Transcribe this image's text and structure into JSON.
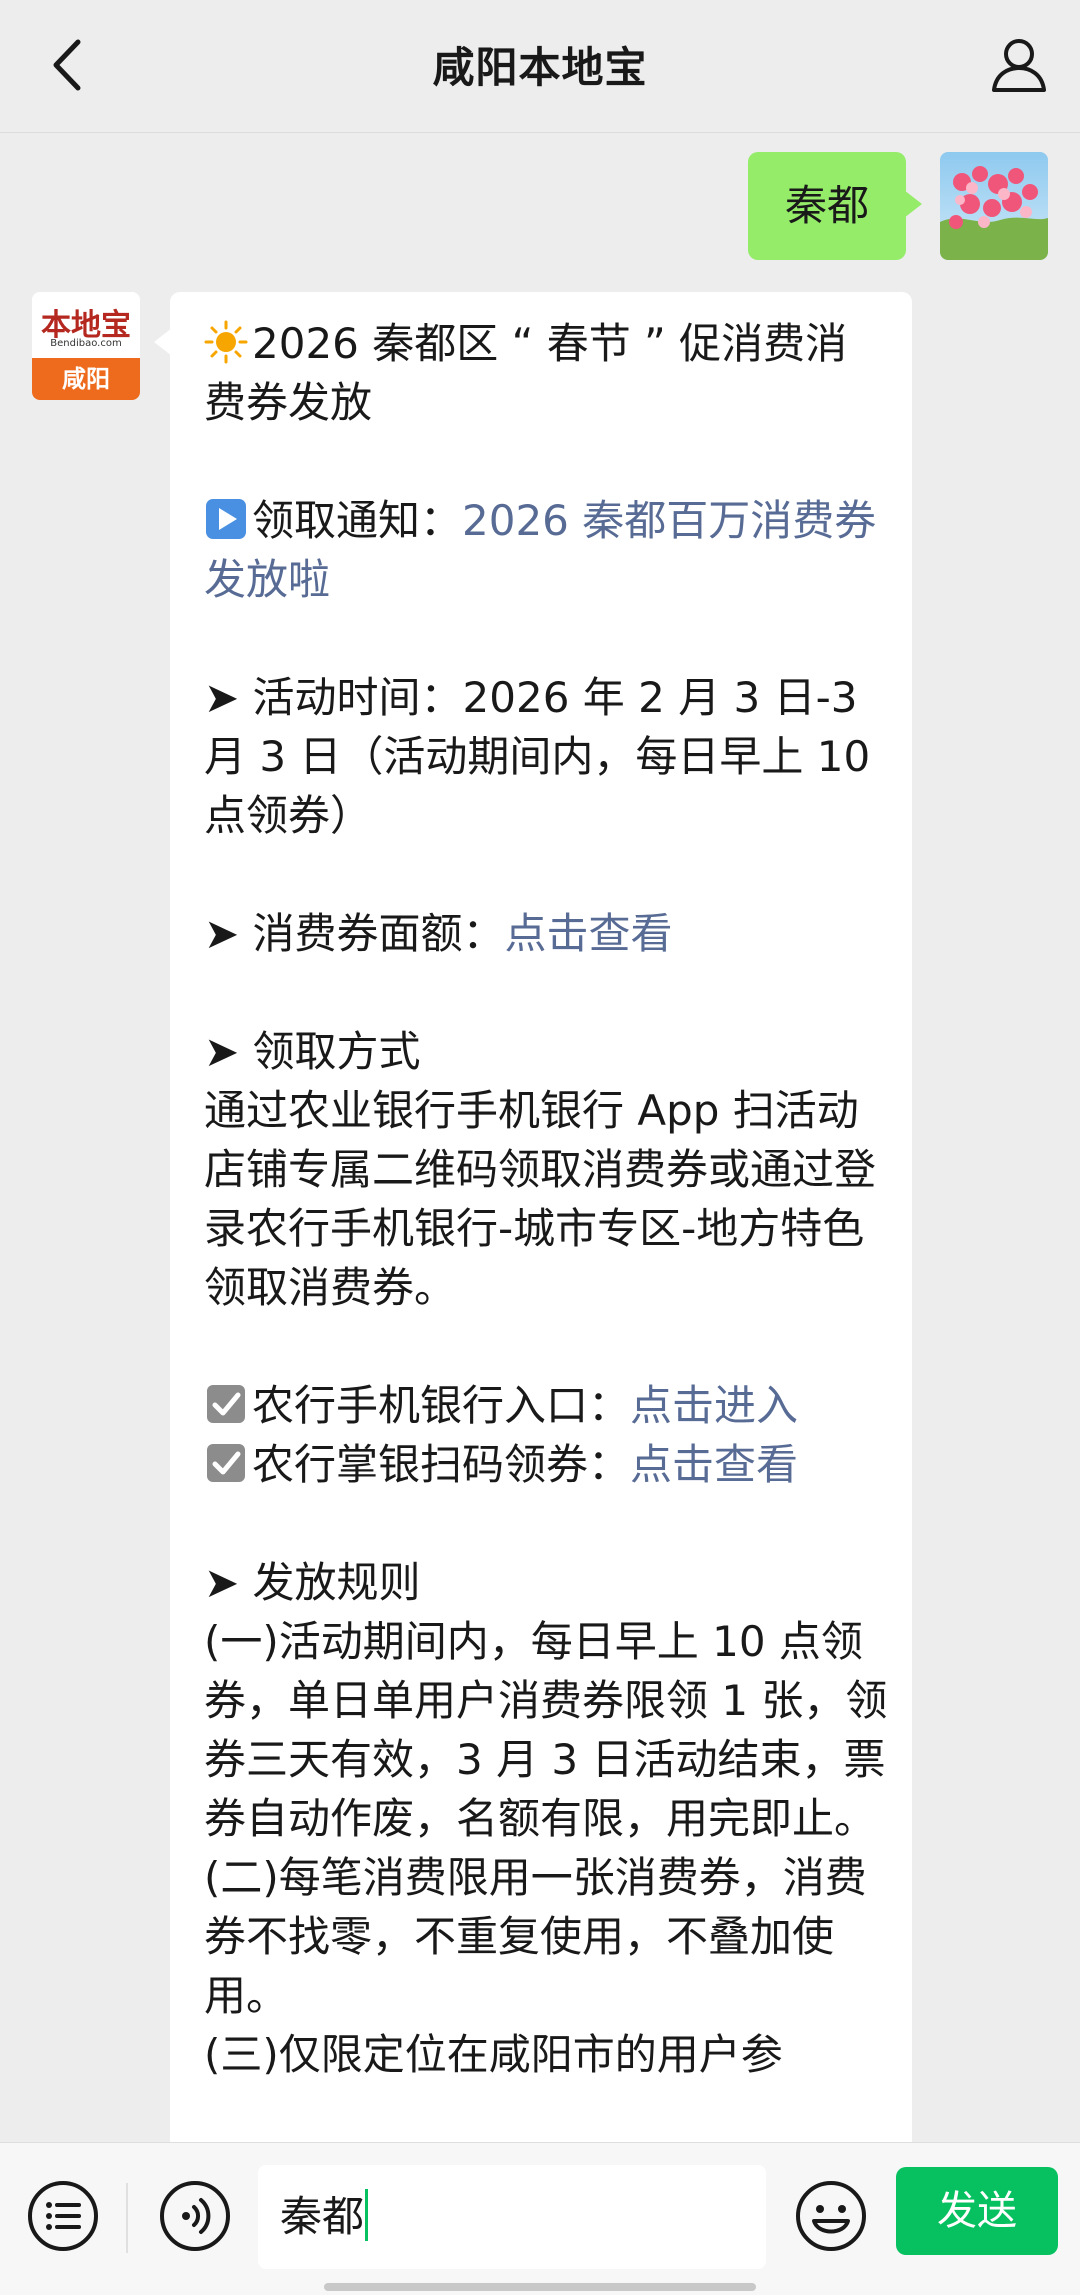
{
  "header": {
    "title": "咸阳本地宝",
    "back_icon": "chevron-left-icon",
    "profile_icon": "user-icon"
  },
  "outgoing_message": {
    "text": "秦都",
    "bubble_color": "#95ec69"
  },
  "incoming_avatar": {
    "brand": "本地宝",
    "domain": "Bendibao.com",
    "city": "咸阳"
  },
  "incoming_message": {
    "title": "2026 秦都区 “ 春节 ” 促消费消费券发放",
    "notice_label": "领取通知：",
    "notice_link": "2026 秦都百万消费券发放啦",
    "time_line": "➤ 活动时间：2026 年 2 月 3 日-3 月 3 日（活动期间内，每日早上 10点领券）",
    "amount_label": "➤ 消费券面额：",
    "amount_link": "点击查看",
    "method_heading": "➤ 领取方式",
    "method_text": "通过农业银行手机银行 App 扫活动店铺专属二维码领取消费券或通过登录农行手机银行-城市专区-地方特色领取消费券。",
    "entry_label": "农行手机银行入口：",
    "entry_link": "点击进入",
    "scan_label": "农行掌银扫码领券：",
    "scan_link": "点击查看",
    "rules_heading": "➤ 发放规则",
    "rule_1": "(一)活动期间内，每日早上 10 点领券，单日单用户消费券限领 1 张，领券三天有效，3 月 3 日活动结束，票券自动作废，名额有限，用完即止。",
    "rule_2": "(二)每笔消费限用一张消费券，消费券不找零，不重复使用，不叠加使用。",
    "rule_3_partial": "(三)仅限定位在咸阳市的用户参",
    "link_color": "#576b95"
  },
  "input_bar": {
    "input_value": "秦都",
    "send_label": "发送",
    "send_color": "#07c160",
    "list_icon": "list-icon",
    "voice_icon": "voice-icon",
    "emoji_icon": "smiley-icon"
  }
}
